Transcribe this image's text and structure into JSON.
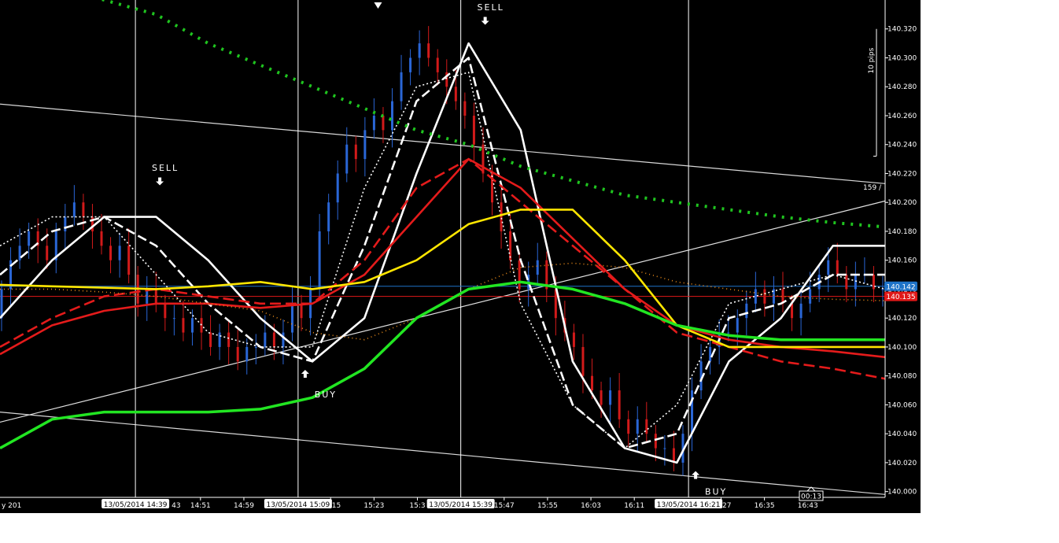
{
  "chart_data": {
    "type": "candlestick",
    "instrument_hint": "USDJPY 1-minute",
    "ylim": [
      139.996,
      140.34
    ],
    "y_ticks": [
      "140.320",
      "140.300",
      "140.280",
      "140.260",
      "140.240",
      "140.220",
      "140.200",
      "140.180",
      "140.160",
      "140.140",
      "140.120",
      "140.100",
      "140.080",
      "140.060",
      "140.040",
      "140.020",
      "140.000"
    ],
    "y_tick_values": [
      140.32,
      140.3,
      140.28,
      140.26,
      140.24,
      140.22,
      140.2,
      140.18,
      140.16,
      140.14,
      140.12,
      140.1,
      140.08,
      140.06,
      140.04,
      140.02,
      140.0
    ],
    "x_ticks": [
      "14:51",
      "14:59",
      "15:15",
      "15:23",
      "15:3",
      "15:47",
      "15:55",
      "16:03",
      "16:11",
      "16:27",
      "16:35",
      "16:43"
    ],
    "x_tick_values": [
      37,
      45,
      61,
      69,
      77,
      93,
      101,
      109,
      117,
      133,
      141,
      149
    ],
    "x_range_minutes": [
      26,
      156
    ],
    "edge_time_fragments": {
      "left": "y 201",
      "after_first": "43"
    },
    "time_markers": [
      {
        "label": "13/05/2014 14:39",
        "minute": 25
      },
      {
        "label": "13/05/2014 15:09",
        "minute": 55
      },
      {
        "label": "13/05/2014 15:39",
        "minute": 85
      },
      {
        "label": "13/05/2014 16:21",
        "minute": 127
      }
    ],
    "countdown": "00:13",
    "price_labels": [
      {
        "label": "140.142",
        "value": 140.142,
        "color": "#1e73c8"
      },
      {
        "label": "140.135",
        "value": 140.135,
        "color": "#e01818"
      }
    ],
    "channel_label": "159 /",
    "scale_note": "10 pips",
    "candles_open": [
      140.12,
      140.14,
      140.16,
      140.17,
      140.18,
      140.17,
      140.16,
      140.18,
      140.19,
      140.2,
      140.19,
      140.18,
      140.17,
      140.16,
      140.17,
      140.15,
      140.13,
      140.14,
      140.13,
      140.12,
      140.12,
      140.11,
      140.12,
      140.11,
      140.1,
      140.11,
      140.1,
      140.09,
      140.1,
      140.1,
      140.11,
      140.1,
      140.11,
      140.13,
      140.12,
      140.14,
      140.18,
      140.2,
      140.22,
      140.24,
      140.23,
      140.25,
      140.26,
      140.25,
      140.27,
      140.29,
      140.3,
      140.31,
      140.3,
      140.29,
      140.28,
      140.27,
      140.26,
      140.24,
      140.22,
      140.2,
      140.18,
      140.16,
      140.14,
      140.15,
      140.16,
      140.14,
      140.12,
      140.11,
      140.1,
      140.08,
      140.07,
      140.06,
      140.07,
      140.05,
      140.04,
      140.05,
      140.04,
      140.03,
      140.03,
      140.02,
      140.04,
      140.07,
      140.09,
      140.1,
      140.11,
      140.11,
      140.12,
      140.13,
      140.14,
      140.13,
      140.14,
      140.13,
      140.12,
      140.13,
      140.14,
      140.15,
      140.16,
      140.15,
      140.14,
      140.15,
      140.15,
      140.14
    ],
    "candles_close": [
      140.14,
      140.16,
      140.17,
      140.18,
      140.17,
      140.16,
      140.18,
      140.19,
      140.2,
      140.19,
      140.18,
      140.17,
      140.16,
      140.17,
      140.15,
      140.13,
      140.14,
      140.13,
      140.12,
      140.12,
      140.11,
      140.12,
      140.11,
      140.1,
      140.11,
      140.1,
      140.09,
      140.1,
      140.1,
      140.11,
      140.1,
      140.11,
      140.13,
      140.12,
      140.14,
      140.18,
      140.2,
      140.22,
      140.24,
      140.23,
      140.25,
      140.26,
      140.25,
      140.27,
      140.29,
      140.3,
      140.31,
      140.3,
      140.29,
      140.28,
      140.27,
      140.26,
      140.24,
      140.22,
      140.2,
      140.18,
      140.16,
      140.14,
      140.15,
      140.16,
      140.14,
      140.12,
      140.11,
      140.1,
      140.08,
      140.07,
      140.06,
      140.07,
      140.05,
      140.04,
      140.05,
      140.04,
      140.03,
      140.03,
      140.02,
      140.04,
      140.07,
      140.09,
      140.1,
      140.11,
      140.11,
      140.12,
      140.13,
      140.14,
      140.13,
      140.14,
      140.13,
      140.12,
      140.13,
      140.14,
      140.15,
      140.16,
      140.15,
      140.14,
      140.15,
      140.15,
      140.14,
      140.14
    ],
    "series": [
      {
        "style": "white-solid",
        "color": "#ffffff",
        "dash": "",
        "x": [
          0,
          10,
          20,
          30,
          40,
          50,
          60,
          70,
          80,
          90,
          100,
          110,
          120,
          130,
          140,
          150,
          160,
          170
        ],
        "y": [
          140.12,
          140.16,
          140.19,
          140.19,
          140.16,
          140.12,
          140.09,
          140.12,
          140.22,
          140.31,
          140.25,
          140.09,
          140.03,
          140.02,
          140.09,
          140.12,
          140.17,
          140.17
        ]
      },
      {
        "style": "white-dashed",
        "color": "#ffffff",
        "dash": "12,5",
        "x": [
          0,
          10,
          20,
          30,
          40,
          50,
          60,
          70,
          80,
          90,
          100,
          110,
          120,
          130,
          140,
          150,
          160,
          170
        ],
        "y": [
          140.15,
          140.18,
          140.19,
          140.17,
          140.13,
          140.1,
          140.09,
          140.17,
          140.27,
          140.3,
          140.16,
          140.06,
          140.03,
          140.04,
          140.12,
          140.13,
          140.15,
          140.15
        ]
      },
      {
        "style": "white-dotted",
        "color": "#ffffff",
        "dash": "2,3",
        "x": [
          0,
          10,
          20,
          30,
          40,
          50,
          60,
          70,
          80,
          90,
          100,
          110,
          120,
          130,
          140,
          150,
          160,
          170
        ],
        "y": [
          140.17,
          140.19,
          140.19,
          140.15,
          140.11,
          140.1,
          140.1,
          140.21,
          140.28,
          140.29,
          140.13,
          140.06,
          140.03,
          140.06,
          140.13,
          140.14,
          140.15,
          140.14
        ]
      },
      {
        "style": "red-solid",
        "color": "#e41b1b",
        "dash": "",
        "x": [
          0,
          10,
          20,
          30,
          40,
          50,
          60,
          70,
          80,
          90,
          100,
          110,
          120,
          130,
          140,
          150,
          160,
          170
        ],
        "y": [
          140.095,
          140.115,
          140.125,
          140.13,
          140.13,
          140.127,
          140.13,
          140.15,
          140.19,
          140.23,
          140.21,
          140.175,
          140.14,
          140.115,
          140.105,
          140.1,
          140.097,
          140.093
        ]
      },
      {
        "style": "red-dashed",
        "color": "#e41b1b",
        "dash": "14,6",
        "x": [
          0,
          10,
          20,
          30,
          40,
          50,
          60,
          70,
          80,
          90,
          100,
          110,
          120,
          130,
          140,
          150,
          160,
          170
        ],
        "y": [
          140.1,
          140.12,
          140.135,
          140.14,
          140.135,
          140.13,
          140.13,
          140.16,
          140.21,
          140.23,
          140.2,
          140.17,
          140.14,
          140.11,
          140.1,
          140.09,
          140.085,
          140.078
        ]
      },
      {
        "style": "yellow-solid",
        "color": "#ffe600",
        "dash": "",
        "x": [
          0,
          10,
          20,
          30,
          40,
          50,
          60,
          70,
          80,
          90,
          100,
          110,
          120,
          130,
          140,
          150,
          160,
          170
        ],
        "y": [
          140.143,
          140.142,
          140.141,
          140.14,
          140.142,
          140.145,
          140.14,
          140.145,
          140.16,
          140.185,
          140.195,
          140.195,
          140.16,
          140.115,
          140.1,
          140.1,
          140.1,
          140.1
        ]
      },
      {
        "style": "orange-dotted",
        "color": "#e88a1a",
        "dash": "1,4",
        "x": [
          0,
          10,
          20,
          30,
          40,
          50,
          60,
          70,
          80,
          90,
          100,
          110,
          120,
          130,
          140,
          150,
          160,
          170
        ],
        "y": [
          140.14,
          140.14,
          140.138,
          140.135,
          140.13,
          140.125,
          140.11,
          140.105,
          140.12,
          140.14,
          140.155,
          140.158,
          140.155,
          140.145,
          140.14,
          140.135,
          140.133,
          140.132
        ]
      },
      {
        "style": "green-solid",
        "color": "#22e622",
        "dash": "",
        "x": [
          0,
          10,
          20,
          30,
          40,
          50,
          60,
          70,
          80,
          90,
          100,
          110,
          120,
          130,
          140,
          150,
          160,
          170
        ],
        "y": [
          140.03,
          140.05,
          140.055,
          140.055,
          140.055,
          140.057,
          140.065,
          140.085,
          140.12,
          140.14,
          140.145,
          140.14,
          140.13,
          140.115,
          140.108,
          140.105,
          140.105,
          140.105
        ]
      },
      {
        "style": "green-dotted",
        "color": "#1fc41f",
        "dash": "3,8",
        "x": [
          10,
          20,
          30,
          40,
          50,
          60,
          70,
          80,
          90,
          100,
          110,
          120,
          130,
          140,
          150,
          160,
          170
        ],
        "y": [
          140.35,
          140.34,
          140.33,
          140.31,
          140.295,
          140.28,
          140.265,
          140.25,
          140.24,
          140.225,
          140.215,
          140.205,
          140.2,
          140.195,
          140.19,
          140.186,
          140.183
        ]
      }
    ],
    "trendlines": [
      {
        "x": [
          0,
          170
        ],
        "y": [
          140.268,
          140.213
        ],
        "color": "#d8d8d8"
      },
      {
        "x": [
          0,
          170
        ],
        "y": [
          140.048,
          140.201
        ],
        "color": "#e0e0e0"
      },
      {
        "x": [
          0,
          170
        ],
        "y": [
          140.055,
          139.998
        ],
        "color": "#d8d8d8"
      }
    ],
    "signals": [
      {
        "label": "SELL",
        "minute": 25,
        "price": 140.214,
        "arrow": "down",
        "text_price": 140.222
      },
      {
        "label": "BUY",
        "minute": 55,
        "price": 140.082,
        "arrow": "up",
        "text_price": 140.065
      },
      {
        "label": "SELL",
        "minute": 85,
        "price": 140.325,
        "arrow": "down",
        "text_price": 140.333
      },
      {
        "label": "BUY",
        "minute": 127,
        "price": 140.012,
        "arrow": "up",
        "text_price": 139.998
      }
    ],
    "extra_arrow": {
      "minute": 68,
      "price": 140.34,
      "arrow": "down-filled"
    },
    "grid": false,
    "legend": "none"
  }
}
